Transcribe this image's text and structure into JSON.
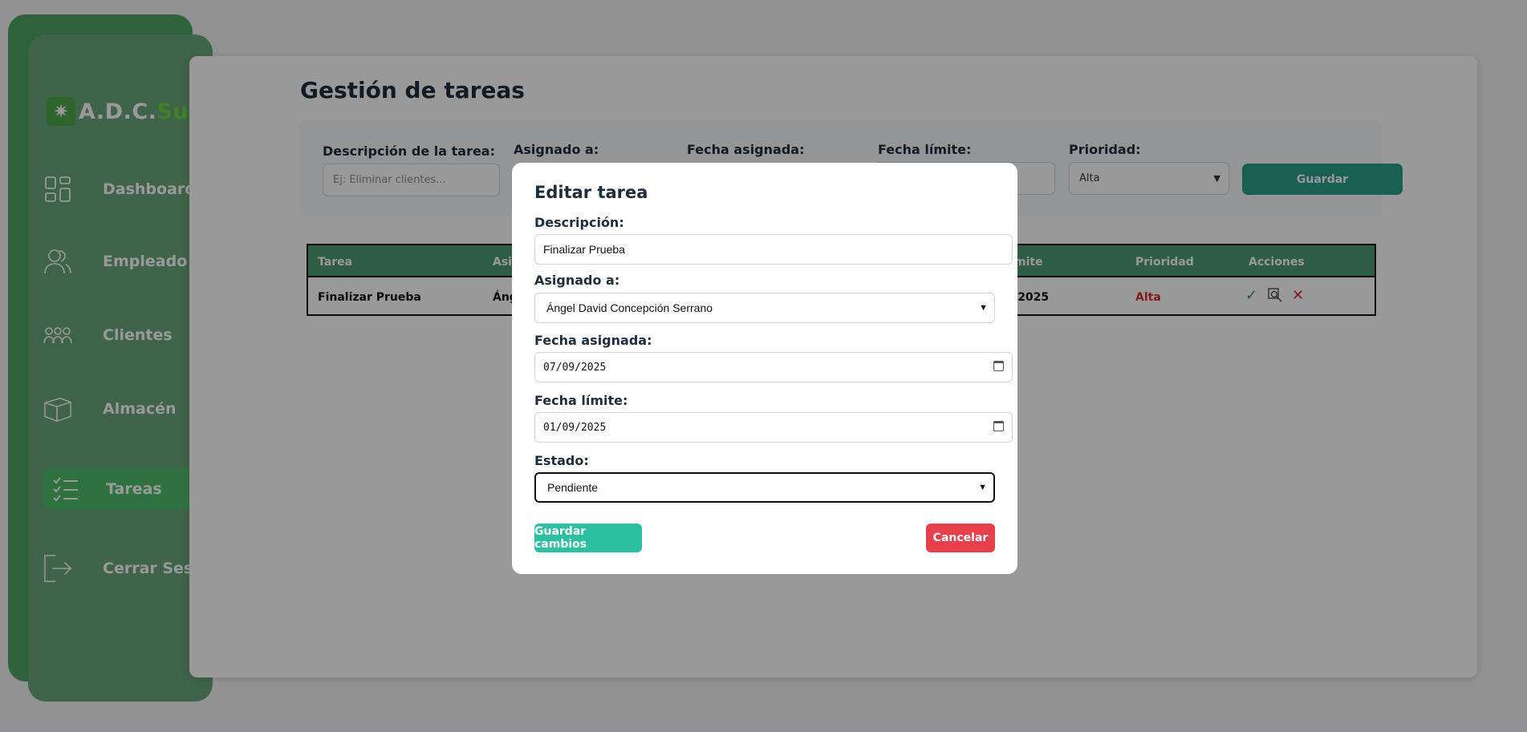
{
  "brand": {
    "prefix": "A.D.C.",
    "suffix": "Suite"
  },
  "sidebar": {
    "items": [
      {
        "label": "Dashboard",
        "icon": "dashboard-grid-icon",
        "active": false
      },
      {
        "label": "Empleado",
        "icon": "users-icon",
        "active": false
      },
      {
        "label": "Clientes",
        "icon": "group-icon",
        "active": false
      },
      {
        "label": "Almacén",
        "icon": "box-icon",
        "active": false
      },
      {
        "label": "Tareas",
        "icon": "checklist-icon",
        "active": true
      },
      {
        "label": "Cerrar Sesión",
        "icon": "logout-icon",
        "active": false
      }
    ]
  },
  "page": {
    "title": "Gestión de tareas"
  },
  "form": {
    "description_label": "Descripción de la tarea:",
    "description_placeholder": "Ej: Eliminar clientes...",
    "assigned_label": "Asignado a:",
    "assigned_date_label": "Fecha asignada:",
    "due_date_label": "Fecha límite:",
    "priority_label": "Prioridad:",
    "priority_value": "Alta",
    "save_label": "Guardar"
  },
  "table": {
    "headers": [
      "Tarea",
      "Asig",
      "mite",
      "Prioridad",
      "Acciones"
    ],
    "rows": [
      {
        "task": "Finalizar Prueba",
        "assigned": "Áng",
        "due": ", 2025",
        "priority": "Alta"
      }
    ],
    "action_icons": [
      "check-icon",
      "view-icon",
      "delete-icon"
    ]
  },
  "modal": {
    "title": "Editar tarea",
    "description_label": "Descripción:",
    "description_value": "Finalizar Prueba",
    "assigned_label": "Asignado a:",
    "assigned_value": "Ángel David Concepción Serrano",
    "assigned_date_label": "Fecha asignada:",
    "assigned_date_value": "07/09/2025",
    "due_date_label": "Fecha límite:",
    "due_date_value": "01/09/2025",
    "status_label": "Estado:",
    "status_value": "Pendiente",
    "save_changes_label": "Guardar cambios",
    "cancel_label": "Cancelar"
  },
  "colors": {
    "sidebar": "#6aa77a",
    "accent_green": "#4fbf6a",
    "teal_button": "#2cbfa2",
    "danger": "#e63e4a",
    "priority_high": "#d92c2c"
  }
}
